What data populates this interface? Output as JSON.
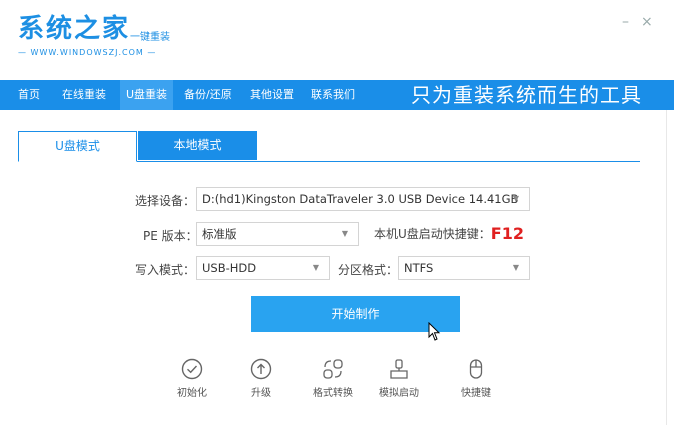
{
  "brand": {
    "name": "系统之家",
    "tagline": "一键重装",
    "url": "WWW.WINDOWSZJ.COM"
  },
  "window": {
    "minimize": "–",
    "close": "×"
  },
  "nav": {
    "items": [
      {
        "label": "首页"
      },
      {
        "label": "在线重装"
      },
      {
        "label": "U盘重装"
      },
      {
        "label": "备份/还原"
      },
      {
        "label": "其他设置"
      },
      {
        "label": "联系我们"
      }
    ],
    "active_index": 2,
    "slogan": "只为重装系统而生的工具"
  },
  "tabs": {
    "usb_mode": "U盘模式",
    "local_mode": "本地模式"
  },
  "form": {
    "device_label": "选择设备：",
    "device_value": "D:(hd1)Kingston DataTraveler 3.0 USB Device 14.41GB",
    "pe_label": "PE 版本：",
    "pe_value": "标准版",
    "hotkey_label": "本机U盘启动快捷键：",
    "hotkey_value": "F12",
    "write_label": "写入模式：",
    "write_value": "USB-HDD",
    "partition_label": "分区格式：",
    "partition_value": "NTFS"
  },
  "start_button": "开始制作",
  "tools": [
    {
      "label": "初始化",
      "icon": "check-circle-icon"
    },
    {
      "label": "升级",
      "icon": "arrow-up-circle-icon"
    },
    {
      "label": "格式转换",
      "icon": "convert-icon"
    },
    {
      "label": "模拟启动",
      "icon": "simulate-boot-icon"
    },
    {
      "label": "快捷键",
      "icon": "mouse-icon"
    }
  ],
  "colors": {
    "accent": "#1a8ee8",
    "button": "#29a3f0",
    "hotkey": "#e02020"
  }
}
